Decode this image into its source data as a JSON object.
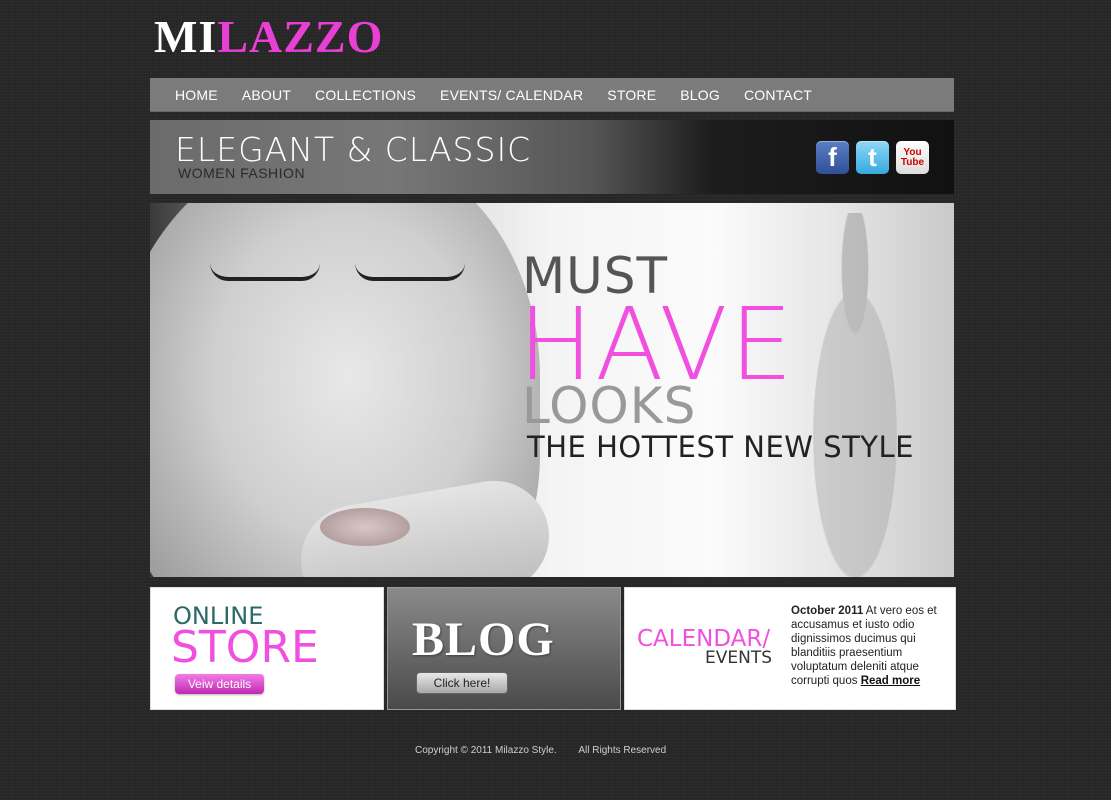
{
  "logo": {
    "part1": "MI",
    "part2": "LAZZO"
  },
  "nav": [
    "HOME",
    "ABOUT",
    "COLLECTIONS",
    "EVENTS/ CALENDAR",
    "STORE",
    "BLOG",
    "CONTACT"
  ],
  "banner": {
    "title": "ELEGANT & CLASSIC",
    "subtitle": "WOMEN FASHION"
  },
  "social": {
    "facebook": "f",
    "twitter": "t",
    "youtube": "You Tube"
  },
  "hero": {
    "line1": "MUST",
    "line2": "HAVE",
    "line3": "LOOKS",
    "line4": "THE HOTTEST NEW STYLE"
  },
  "store": {
    "line1": "ONLINE",
    "line2": "STORE",
    "button": "Veiw details"
  },
  "blog": {
    "title": "BLOG",
    "button": "Click here!"
  },
  "calendar": {
    "line1": "CALENDAR/",
    "line2": "EVENTS",
    "date": "October  2011",
    "text": " At vero eos et accusamus et iusto odio dignissimos ducimus qui blanditiis praesentium voluptatum deleniti atque corrupti quos ",
    "link": "Read more"
  },
  "footer": "Copyright © 2011 Milazzo Style.        All Rights Reserved",
  "colors": {
    "accent": "#e83fd4",
    "nav_bg": "#7b7b7b",
    "page_bg": "#262626"
  }
}
